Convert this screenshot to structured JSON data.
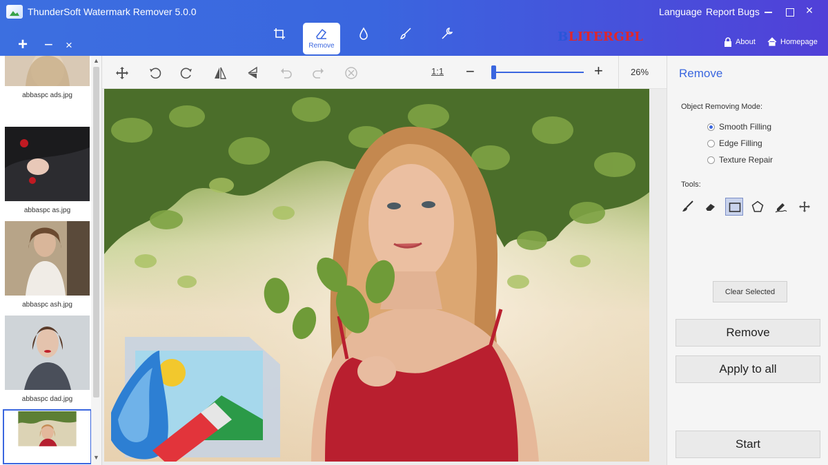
{
  "app": {
    "title": "ThunderSoft Watermark Remover 5.0.0",
    "language_label": "Language",
    "report_label": "Report Bugs",
    "close_glyph": "×",
    "about_label": "About",
    "home_label": "Homepage",
    "brand_prefix": "B",
    "brand_rest": "LITERGPL"
  },
  "file_actions": {
    "add": "+",
    "remove": "−",
    "clear": "×"
  },
  "tabs": [
    {
      "label": "",
      "icon": "crop-icon"
    },
    {
      "label": "Remove",
      "icon": "eraser-icon",
      "active": true
    },
    {
      "label": "",
      "icon": "drop-icon"
    },
    {
      "label": "",
      "icon": "brush-icon"
    },
    {
      "label": "",
      "icon": "wrench-icon"
    }
  ],
  "thumbnails": [
    {
      "name": "abbaspc ads.jpg"
    },
    {
      "name": "abbaspc as.jpg"
    },
    {
      "name": "abbaspc ash.jpg"
    },
    {
      "name": "abbaspc dad.jpg"
    },
    {
      "name": "",
      "selected": true
    }
  ],
  "scroll": {
    "up": "▲",
    "down": "▼"
  },
  "toolbar": {
    "ratio_label": "1:1",
    "zoom_minus": "−",
    "zoom_plus": "+",
    "zoom_value": "26%",
    "zoom_fraction": 0.0
  },
  "panel": {
    "title": "Remove",
    "mode_label": "Object Removing Mode:",
    "modes": [
      {
        "label": "Smooth Filling",
        "checked": true
      },
      {
        "label": "Edge Filling",
        "checked": false
      },
      {
        "label": "Texture Repair",
        "checked": false
      }
    ],
    "tools_label": "Tools:",
    "tools": [
      "brush-icon",
      "eraser-icon",
      "rectangle-icon",
      "polygon-icon",
      "magic-pen-icon",
      "move-icon"
    ],
    "active_tool": "rectangle-icon",
    "clear_label": "Clear Selected",
    "remove_label": "Remove",
    "apply_label": "Apply to all",
    "start_label": "Start"
  },
  "colors": {
    "accent": "#3a66df",
    "brand_red": "#e0262b"
  }
}
